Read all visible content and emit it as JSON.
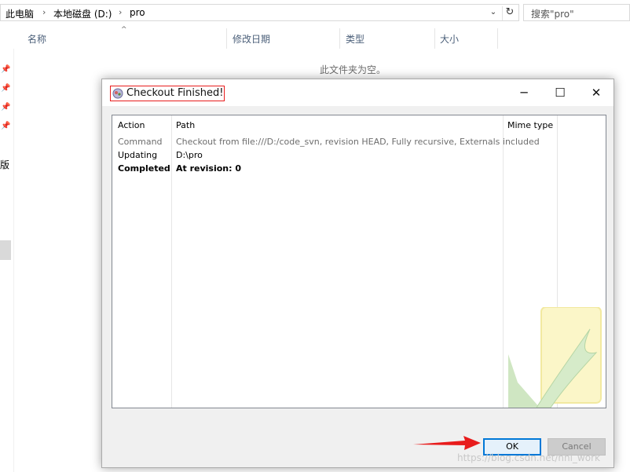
{
  "explorer": {
    "breadcrumb": [
      "此电脑",
      "本地磁盘 (D:)",
      "pro"
    ],
    "search_placeholder": "搜索\"pro\"",
    "columns": [
      "名称",
      "修改日期",
      "类型",
      "大小"
    ],
    "empty_message": "此文件夹为空。",
    "side_fragment": "版"
  },
  "dialog": {
    "title": "Checkout Finished!",
    "headers": {
      "action": "Action",
      "path": "Path",
      "mime": "Mime type"
    },
    "rows": [
      {
        "action": "Command",
        "path": "Checkout from file:///D:/code_svn, revision HEAD, Fully recursive, Externals included"
      },
      {
        "action": "Updating",
        "path": "D:\\pro"
      },
      {
        "action": "Completed",
        "path": "At revision: 0"
      }
    ],
    "ok_label": "OK",
    "cancel_label": "Cancel"
  },
  "watermark_text": "https://blog.csdn.net/hhl_work",
  "colors": {
    "accent": "#0078d7",
    "highlight": "#e81c1c"
  }
}
